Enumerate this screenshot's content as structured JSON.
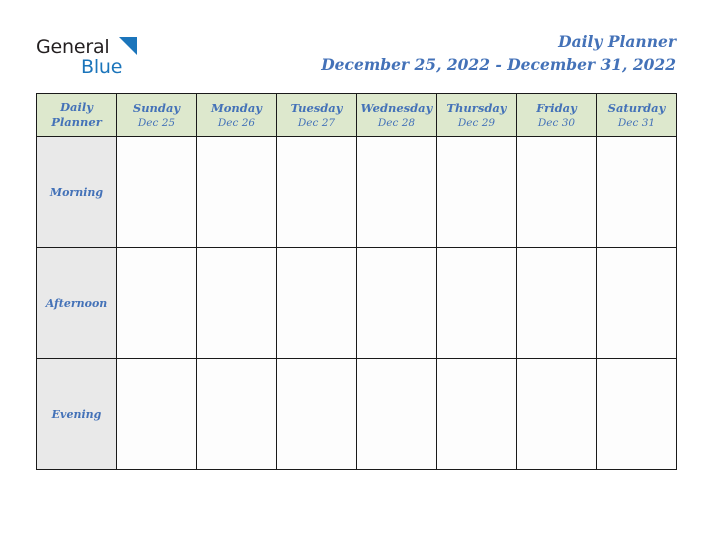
{
  "brand": {
    "logo_text_primary": "General",
    "logo_text_secondary": "Blue",
    "logo_triangle": "blue-triangle-icon",
    "primary_color": "#1b75bb",
    "text_color": "#231f20"
  },
  "header": {
    "title": "Daily Planner",
    "date_range": "December 25, 2022 - December 31, 2022",
    "title_color": "#4472b8"
  },
  "table": {
    "corner_label_line1": "Daily",
    "corner_label_line2": "Planner",
    "header_background": "#dde8cd",
    "row_label_background": "#e9e9e9",
    "cell_background": "#fdfdfd",
    "border_color": "#1a1a1a",
    "columns": [
      {
        "day": "Sunday",
        "date": "Dec 25"
      },
      {
        "day": "Monday",
        "date": "Dec 26"
      },
      {
        "day": "Tuesday",
        "date": "Dec 27"
      },
      {
        "day": "Wednesday",
        "date": "Dec 28"
      },
      {
        "day": "Thursday",
        "date": "Dec 29"
      },
      {
        "day": "Friday",
        "date": "Dec 30"
      },
      {
        "day": "Saturday",
        "date": "Dec 31"
      }
    ],
    "rows": [
      {
        "label": "Morning",
        "entries": [
          "",
          "",
          "",
          "",
          "",
          "",
          ""
        ]
      },
      {
        "label": "Afternoon",
        "entries": [
          "",
          "",
          "",
          "",
          "",
          "",
          ""
        ]
      },
      {
        "label": "Evening",
        "entries": [
          "",
          "",
          "",
          "",
          "",
          "",
          ""
        ]
      }
    ]
  }
}
